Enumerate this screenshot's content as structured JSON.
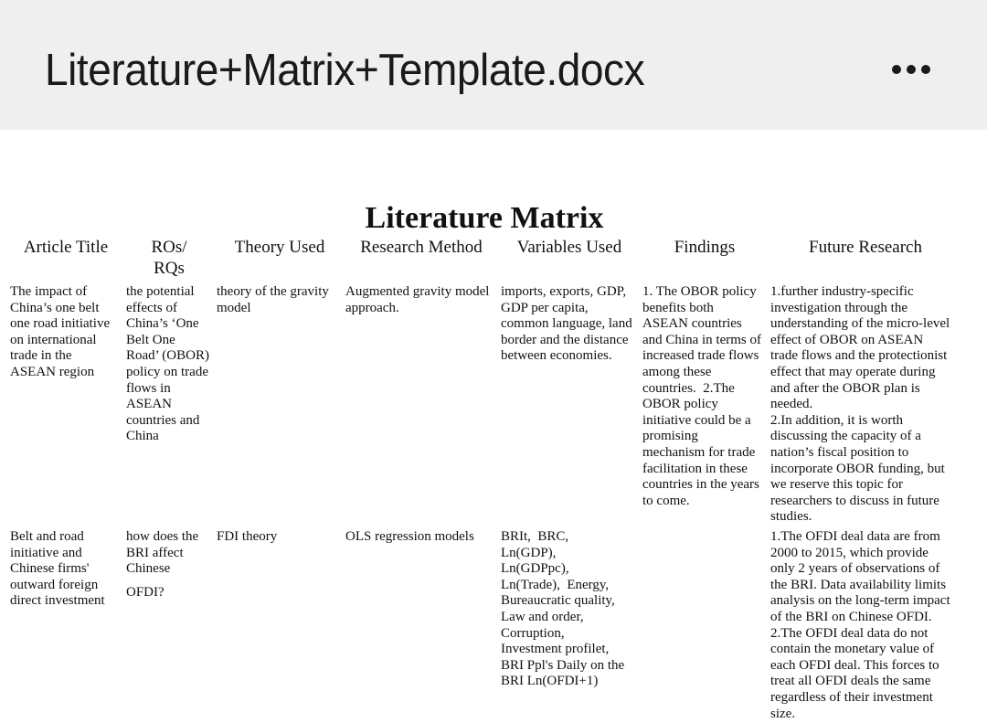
{
  "app": {
    "file_name": "Literature+Matrix+Template.docx",
    "more_icon": "more-horizontal-icon"
  },
  "document": {
    "title": "Literature Matrix",
    "headers": [
      "Article Title",
      "ROs/\nRQs",
      "Theory Used",
      "Research Method",
      "Variables Used",
      "Findings",
      "Future Research"
    ],
    "rows": [
      {
        "article_title": [
          "The impact of",
          "China’s one belt",
          "one road initiative",
          "on international",
          "trade in the",
          "ASEAN region"
        ],
        "ros_rqs": [
          "the potential",
          "effects of",
          "China’s ‘One",
          "Belt One",
          "Road’ (OBOR)",
          "policy on trade",
          "flows in",
          "ASEAN",
          "countries and",
          "China"
        ],
        "theory_used": [
          "theory of the gravity",
          "model"
        ],
        "research_method": [
          "Augmented gravity model",
          "approach."
        ],
        "variables_used": [
          "imports, exports, GDP,",
          "GDP per capita,",
          "common language, land",
          "border and the distance",
          "between economies."
        ],
        "findings": [
          "1. The OBOR policy",
          "benefits both",
          "ASEAN countries",
          "and China in terms of",
          "increased trade flows",
          "among these",
          "countries.  2.The",
          "OBOR policy",
          "initiative could be a",
          "promising",
          "mechanism for trade",
          "facilitation in these",
          "countries in the years",
          "to come."
        ],
        "future_research": [
          "1.further industry-specific",
          "investigation through the",
          "understanding of the micro-level",
          "effect of OBOR on ASEAN",
          "trade flows and the protectionist",
          "effect that may operate during",
          "and after the OBOR plan is",
          "needed.",
          "2.In addition, it is worth",
          "discussing the capacity of a",
          "nation’s fiscal position to",
          "incorporate OBOR funding, but",
          "we reserve this topic for",
          "researchers to discuss in future",
          "studies."
        ]
      },
      {
        "article_title": [
          "Belt and road",
          "initiative and",
          "Chinese firms'",
          "outward foreign",
          "direct investment"
        ],
        "ros_rqs": [
          "how does the",
          "BRI affect",
          "Chinese",
          "",
          "OFDI?"
        ],
        "theory_used": [
          "FDI theory"
        ],
        "research_method": [
          "OLS regression models"
        ],
        "variables_used": [
          "BRIt,  BRC,",
          "Ln(GDP),",
          "Ln(GDPpc),",
          "Ln(Trade),  Energy,",
          "Bureaucratic quality,",
          "Law and order,",
          "Corruption,",
          "Investment profilet,",
          "BRI Ppl's Daily on the",
          "BRI Ln(OFDI+1)"
        ],
        "findings": [],
        "future_research": [
          "1.The OFDI deal data are from",
          "2000 to 2015, which provide",
          "only 2 years of observations of",
          "the BRI. Data availability limits",
          "analysis on the long-term impact",
          "of the BRI on Chinese OFDI.",
          "2.The OFDI deal data do not",
          "contain the monetary value of",
          "each OFDI deal. This forces to",
          "treat all OFDI deals the same",
          "regardless of their investment",
          "size."
        ]
      }
    ]
  }
}
